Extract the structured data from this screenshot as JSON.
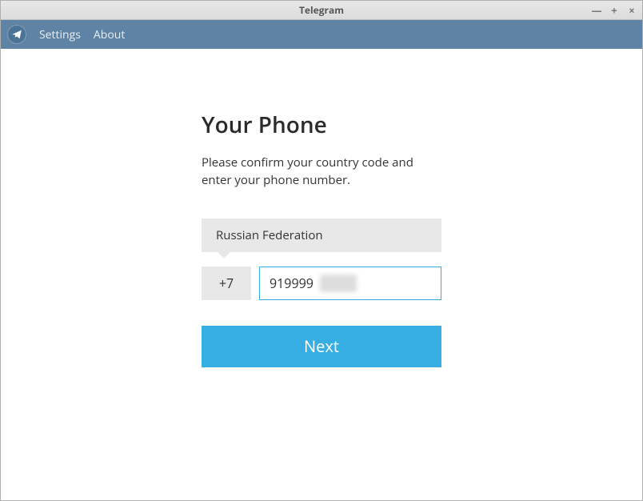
{
  "window": {
    "title": "Telegram"
  },
  "menu": {
    "settings": "Settings",
    "about": "About"
  },
  "form": {
    "heading": "Your Phone",
    "subtext": "Please confirm your country code and enter your phone number.",
    "country": "Russian Federation",
    "country_code": "+7",
    "phone_value": "919999",
    "next_label": "Next"
  }
}
